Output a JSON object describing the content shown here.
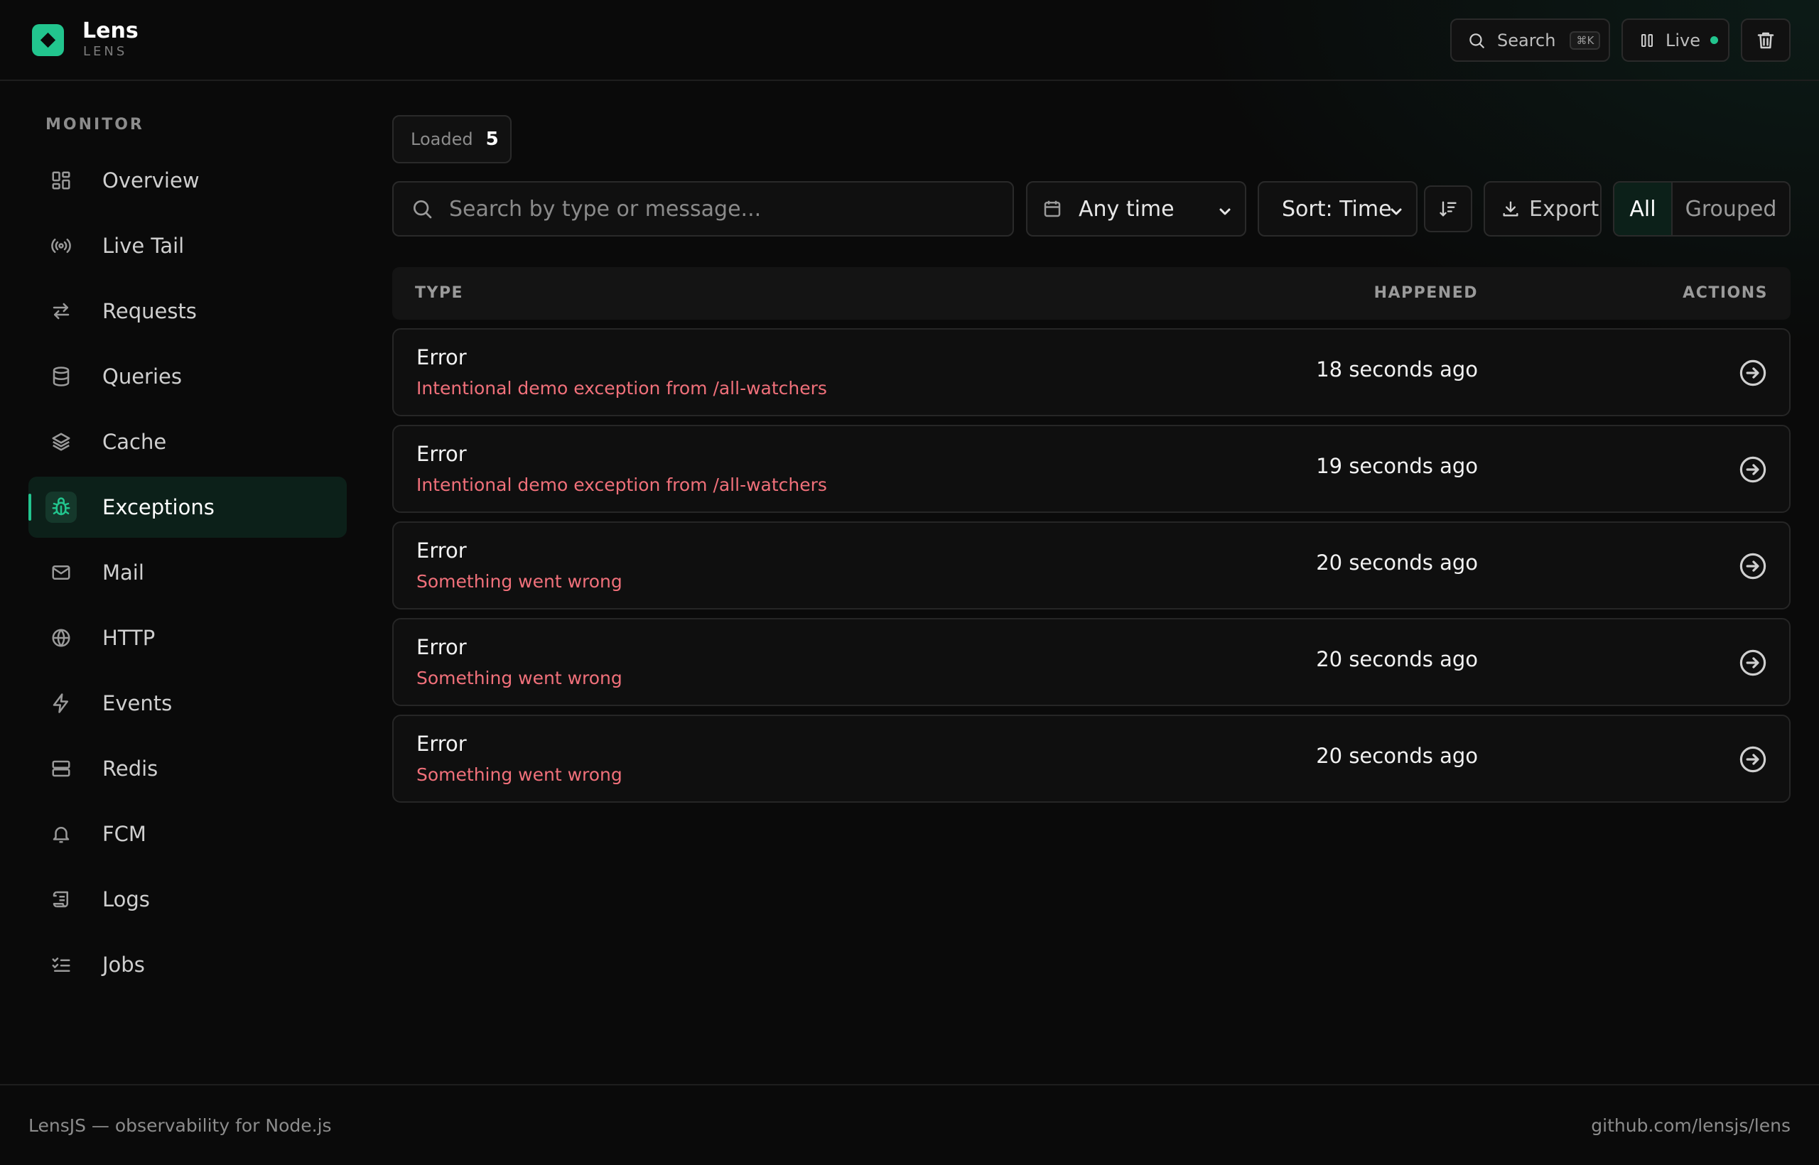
{
  "app": {
    "name": "Lens",
    "subtitle": "LENS"
  },
  "header": {
    "search_label": "Search",
    "search_shortcut": "⌘K",
    "live_label": "Live"
  },
  "sidebar": {
    "section": "MONITOR",
    "items": [
      {
        "label": "Overview",
        "icon": "grid-icon"
      },
      {
        "label": "Live Tail",
        "icon": "broadcast-icon"
      },
      {
        "label": "Requests",
        "icon": "arrows-icon"
      },
      {
        "label": "Queries",
        "icon": "database-icon"
      },
      {
        "label": "Cache",
        "icon": "layers-icon"
      },
      {
        "label": "Exceptions",
        "icon": "bug-icon",
        "active": true
      },
      {
        "label": "Mail",
        "icon": "mail-icon"
      },
      {
        "label": "HTTP",
        "icon": "globe-icon"
      },
      {
        "label": "Events",
        "icon": "bolt-icon"
      },
      {
        "label": "Redis",
        "icon": "server-icon"
      },
      {
        "label": "FCM",
        "icon": "bell-icon"
      },
      {
        "label": "Logs",
        "icon": "scroll-icon"
      },
      {
        "label": "Jobs",
        "icon": "list-check-icon"
      }
    ]
  },
  "main": {
    "loaded_label": "Loaded",
    "loaded_count": "5",
    "search_placeholder": "Search by type or message...",
    "time_filter": "Any time",
    "sort": "Sort: Time",
    "export_label": "Export",
    "view_all": "All",
    "view_grouped": "Grouped",
    "columns": {
      "type": "TYPE",
      "happened": "HAPPENED",
      "actions": "ACTIONS"
    },
    "rows": [
      {
        "type": "Error",
        "message": "Intentional demo exception from /all-watchers",
        "happened": "18 seconds ago"
      },
      {
        "type": "Error",
        "message": "Intentional demo exception from /all-watchers",
        "happened": "19 seconds ago"
      },
      {
        "type": "Error",
        "message": "Something went wrong",
        "happened": "20 seconds ago"
      },
      {
        "type": "Error",
        "message": "Something went wrong",
        "happened": "20 seconds ago"
      },
      {
        "type": "Error",
        "message": "Something went wrong",
        "happened": "20 seconds ago"
      }
    ]
  },
  "footer": {
    "left": "LensJS — observability for Node.js",
    "right": "github.com/lensjs/lens"
  },
  "colors": {
    "accent": "#22c58e",
    "error_text": "#f0707a",
    "background": "#0a0a0a"
  }
}
